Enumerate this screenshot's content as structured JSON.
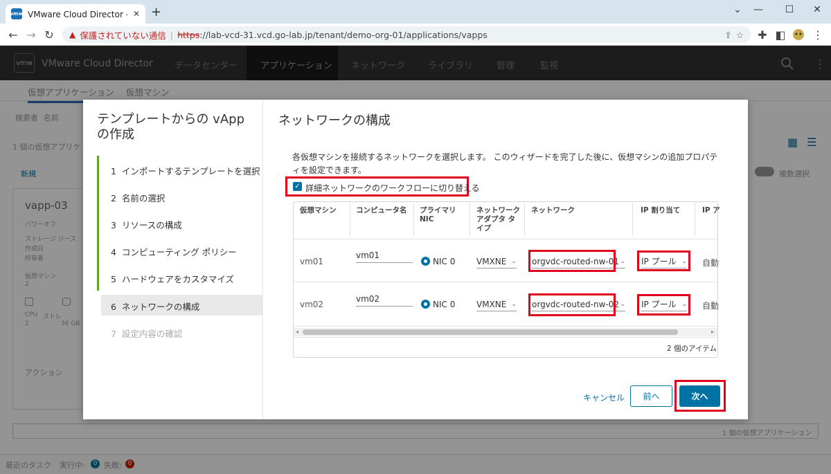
{
  "browser": {
    "tab_title": "VMware Cloud Director - 仮想ア",
    "security_label": "保護されていない通信",
    "url_scheme": "https",
    "url_rest": "://lab-vcd-31.vcd.go-lab.jp/tenant/demo-org-01/applications/vapps"
  },
  "app": {
    "logo": "vmw",
    "name": "VMware Cloud Director",
    "nav": [
      "データセンター",
      "アプリケーション",
      "ネットワーク",
      "ライブラリ",
      "管理",
      "監視"
    ],
    "subnav": [
      "仮想アプリケーション",
      "仮想マシン"
    ]
  },
  "background": {
    "search_by": "検索者",
    "search_field": "名前",
    "vapp_count": "1 個の仮想アプリケ",
    "new_label": "新規",
    "multi_select": "複数選択",
    "vapp_name": "vapp-03",
    "power_state": "パワーオフ",
    "lease": "ストレージ リース",
    "created": "作成日",
    "owner": "所有者",
    "vms_label": "仮想マシン",
    "vms_count": "2",
    "cpu": "CPU",
    "cpu_value": "2",
    "storage": "ストレ",
    "storage_value": "36 GB",
    "actions": "アクション",
    "footer_count": "1 個の仮想アプリケーション",
    "tasks": "最近のタスク",
    "running": "実行中:",
    "running_count": "0",
    "failed": "失敗:",
    "failed_count": "0"
  },
  "wizard": {
    "title": "テンプレートからの vApp の作成",
    "steps": [
      {
        "num": "1",
        "label": "インポートするテンプレートを選択"
      },
      {
        "num": "2",
        "label": "名前の選択"
      },
      {
        "num": "3",
        "label": "リソースの構成"
      },
      {
        "num": "4",
        "label": "コンピューティング ポリシー"
      },
      {
        "num": "5",
        "label": "ハードウェアをカスタマイズ"
      },
      {
        "num": "6",
        "label": "ネットワークの構成"
      },
      {
        "num": "7",
        "label": "設定内容の確認"
      }
    ],
    "panel_title": "ネットワークの構成",
    "description": "各仮想マシンを接続するネットワークを選択します。 このウィザードを完了した後に、仮想マシンの追加プロパティを設定できます。",
    "advanced_checkbox": "詳細ネットワークのワークフローに切り替える",
    "table": {
      "headers": {
        "vm": "仮想マシン",
        "computer_name": "コンピュータ名",
        "primary_nic": "プライマリ NIC",
        "adapter_type": "ネットワーク アダプタ タイプ",
        "network": "ネットワーク",
        "ip_assign": "IP 割り当て",
        "ip_address": "IP ア"
      },
      "rows": [
        {
          "vm": "vm01",
          "computer_name": "vm01",
          "nic": "NIC 0",
          "adapter": "VMXNE",
          "network": "orgvdc-routed-nw-01",
          "ip_assign": "IP プール",
          "ip_address": "自動"
        },
        {
          "vm": "vm02",
          "computer_name": "vm02",
          "nic": "NIC 0",
          "adapter": "VMXNE",
          "network": "orgvdc-routed-nw-02",
          "ip_assign": "IP プール",
          "ip_address": "自動"
        }
      ],
      "item_count": "2 個のアイテム"
    },
    "buttons": {
      "cancel": "キャンセル",
      "prev": "前へ",
      "next": "次へ"
    }
  },
  "colors": {
    "accent": "#0072a3",
    "highlight": "#e0001b",
    "progress": "#62a420"
  }
}
